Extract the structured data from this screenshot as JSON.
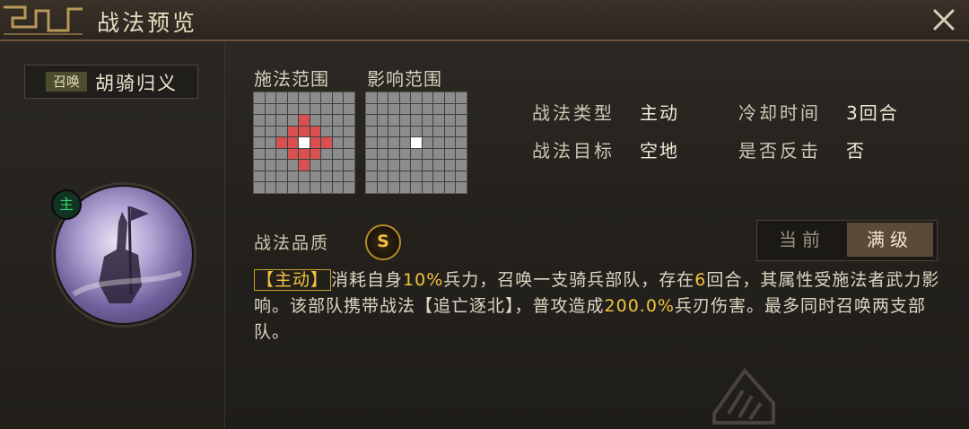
{
  "window": {
    "title": "战法预览"
  },
  "skill": {
    "summon_tag": "召唤",
    "name": "胡骑归义",
    "role_badge": "主"
  },
  "range": {
    "cast_label": "施法范围",
    "effect_label": "影响范围"
  },
  "info": {
    "type_label": "战法类型",
    "type_value": "主动",
    "cooldown_label": "冷却时间",
    "cooldown_value": "3回合",
    "target_label": "战法目标",
    "target_value": "空地",
    "counter_label": "是否反击",
    "counter_value": "否"
  },
  "quality": {
    "label": "战法品质",
    "grade": "S"
  },
  "level_toggle": {
    "current_label": "当前",
    "max_label": "满级",
    "selected": "满级"
  },
  "description": {
    "tag": "【主动】",
    "p1": "消耗自身",
    "v1": "10%",
    "p2": "兵力，召唤一支骑兵部队，存在",
    "v2": "6",
    "p3": "回合，其属性受施法者武力影响。该部队携带战法【追亡逐北】，普攻造成",
    "v3": "200.0%",
    "p4": "兵刃伤害。最多同时召唤两支部队。"
  },
  "colors": {
    "accent_gold": "#f2c23a",
    "range_hit": "#d85050",
    "range_center": "#ffffff",
    "role_green": "#35d26a"
  },
  "icons": {
    "close": "close-icon",
    "quality": "quality-s-icon"
  }
}
